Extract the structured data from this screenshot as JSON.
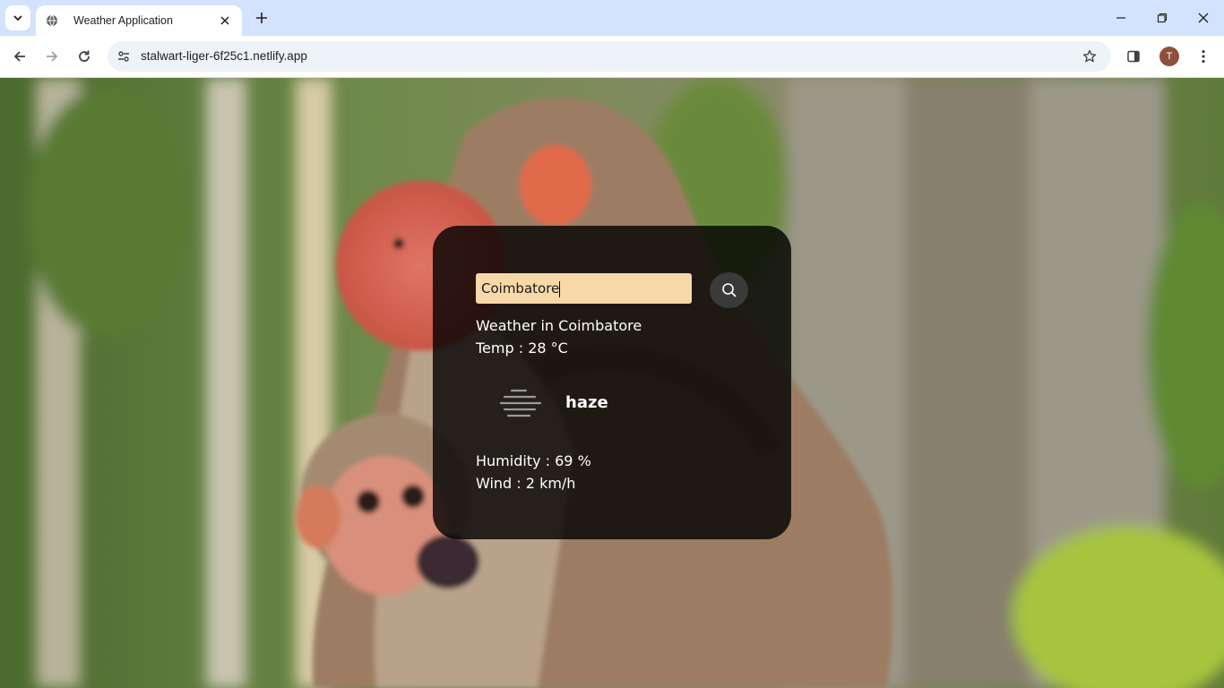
{
  "browser": {
    "tab_title": "Weather Application",
    "url": "stalwart-liger-6f25c1.netlify.app",
    "profile_initial": "T"
  },
  "weather": {
    "search_value": "Coimbatore",
    "city_label": "Weather in",
    "city": "Coimbatore",
    "temp_label": "Temp :",
    "temp_value": "28",
    "temp_unit": "°C",
    "condition": "haze",
    "condition_icon": "haze-icon",
    "humidity_label": "Humidity :",
    "humidity_value": "69",
    "humidity_unit": "%",
    "wind_label": "Wind :",
    "wind_value": "2",
    "wind_unit": "km/h"
  },
  "colors": {
    "input_bg": "#f7d8a8",
    "card_bg": "rgba(0,0,0,0.80)",
    "tabstrip_bg": "#d3e3fd"
  }
}
